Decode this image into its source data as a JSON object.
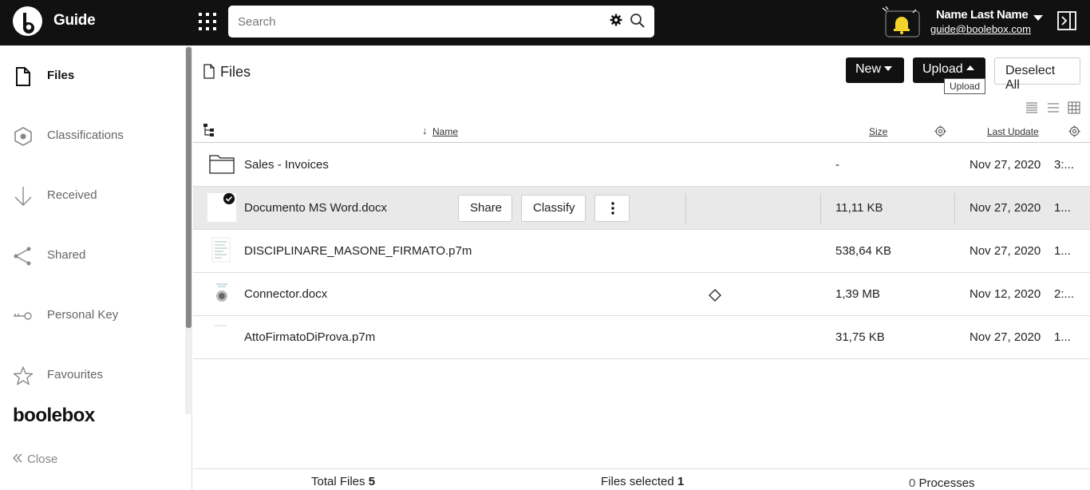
{
  "header": {
    "app_title": "Guide",
    "search_placeholder": "Search",
    "user_name": "Name Last Name",
    "user_email": "guide@boolebox.com"
  },
  "sidebar": {
    "items": [
      {
        "label": "Files",
        "icon": "file-icon",
        "active": true
      },
      {
        "label": "Classifications",
        "icon": "hexagon-icon",
        "active": false
      },
      {
        "label": "Received",
        "icon": "arrow-down-icon",
        "active": false
      },
      {
        "label": "Shared",
        "icon": "share-icon",
        "active": false
      },
      {
        "label": "Personal Key",
        "icon": "key-icon",
        "active": false
      },
      {
        "label": "Favourites",
        "icon": "star-icon",
        "active": false
      }
    ],
    "brand": "boolebox",
    "close_label": "Close"
  },
  "main": {
    "title": "Files",
    "new_label": "New",
    "upload_label": "Upload",
    "upload_tooltip": "Upload",
    "deselect_label": "Deselect All",
    "columns": {
      "name": "Name",
      "size": "Size",
      "last_update": "Last Update"
    },
    "rows": [
      {
        "name": "Sales - Invoices",
        "size": "-",
        "date": "Nov 27, 2020",
        "time": "3:...",
        "type": "folder"
      },
      {
        "name": "Documento MS Word.docx",
        "size": "11,11 KB",
        "date": "Nov 27, 2020",
        "time": "1...",
        "type": "doc",
        "selected": true
      },
      {
        "name": "DISCIPLINARE_MASONE_FIRMATO.p7m",
        "size": "538,64 KB",
        "date": "Nov 27, 2020",
        "time": "1...",
        "type": "doc"
      },
      {
        "name": "Connector.docx",
        "size": "1,39 MB",
        "date": "Nov 12, 2020",
        "time": "2:...",
        "type": "doc"
      },
      {
        "name": "AttoFirmatoDiProva.p7m",
        "size": "31,75 KB",
        "date": "Nov 27, 2020",
        "time": "1...",
        "type": "doc"
      }
    ],
    "row_actions": {
      "share": "Share",
      "classify": "Classify"
    },
    "footer": {
      "total_files_label": "Total Files",
      "total_files_value": "5",
      "files_selected_label": "Files selected",
      "files_selected_value": "1",
      "processes_value": "0",
      "processes_label": "Processes"
    }
  }
}
